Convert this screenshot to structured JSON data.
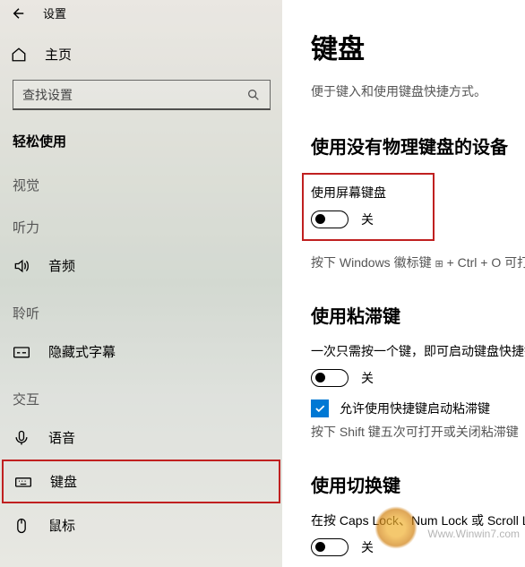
{
  "header": {
    "title": "设置"
  },
  "home": {
    "label": "主页"
  },
  "search": {
    "placeholder": "查找设置"
  },
  "category": "轻松使用",
  "sections": {
    "vision": "视觉",
    "hearing": "听力",
    "narration": "聆听",
    "interaction": "交互"
  },
  "nav": {
    "audio": "音频",
    "captions": "隐藏式字幕",
    "speech": "语音",
    "keyboard": "键盘",
    "mouse": "鼠标"
  },
  "main": {
    "title": "键盘",
    "desc": "便于键入和使用键盘快捷方式。",
    "section1": {
      "title": "使用没有物理键盘的设备",
      "label": "使用屏幕键盘",
      "toggle_state": "关",
      "hint_prefix": "按下 Windows 徽标键 ",
      "hint_suffix": " + Ctrl + O 可打"
    },
    "section2": {
      "title": "使用粘滞键",
      "desc": "一次只需按一个键，即可启动键盘快捷键",
      "toggle_state": "关",
      "checkbox_label": "允许使用快捷键启动粘滞键",
      "hint": "按下 Shift 键五次可打开或关闭粘滞键"
    },
    "section3": {
      "title": "使用切换键",
      "desc": "在按 Caps Lock、Num Lock 或 Scroll Lo",
      "toggle_state": "关"
    }
  },
  "watermark": "Www.Winwin7.com"
}
